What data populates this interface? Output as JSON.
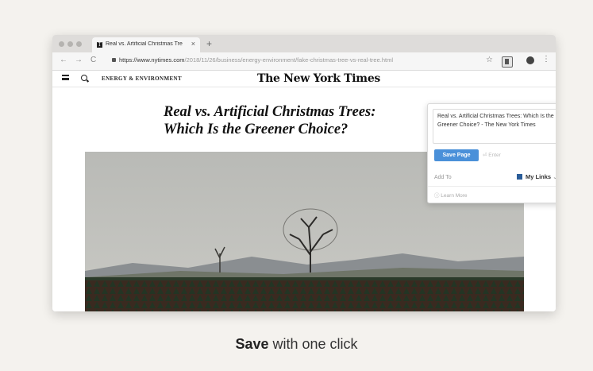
{
  "browser": {
    "tab_title": "Real vs. Artificial Christmas Tre",
    "tab_close": "×",
    "new_tab": "+",
    "back": "←",
    "forward": "→",
    "reload": "C",
    "url_host": "https://www.nytimes.com",
    "url_path": "/2018/11/26/business/energy-environment/fake-christmas-tree-vs-real-tree.html",
    "star": "☆",
    "menu": "⋮"
  },
  "site": {
    "section": "ENERGY & ENVIRONMENT",
    "masthead": "The New York Times",
    "headline_line1": "Real vs. Artificial Christmas Trees:",
    "headline_line2": "Which Is the Greener Choice?"
  },
  "popup": {
    "title_text": "Real vs. Artificial Christmas Trees: Which Is the Greener Choice? - The New York Times",
    "save_button": "Save Page",
    "enter_hint": "⏎ Enter",
    "add_to_label": "Add To",
    "collection": "My Links",
    "collection_chevron": "⌄",
    "learn_more": "ⓘ Learn More"
  },
  "caption": {
    "bold": "Save",
    "rest": " with one click"
  },
  "colors": {
    "accent": "#4a90d9",
    "background": "#f4f2ee"
  }
}
